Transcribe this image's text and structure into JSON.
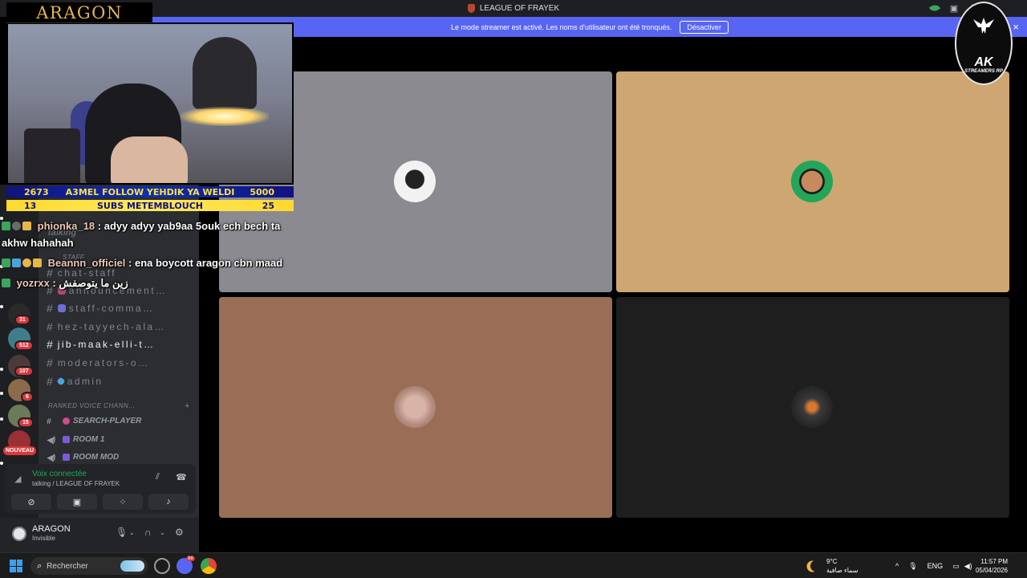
{
  "window": {
    "title": "LEAGUE OF FRAYEK"
  },
  "banner": {
    "text": "Le mode streamer est activé. Les noms d'utilisateur ont été tronqués.",
    "button": "Désactiver",
    "close": "×"
  },
  "overlay": {
    "logo": "ARAGON",
    "stats_row1": {
      "left": "2673",
      "middle": "A3MEL FOLLOW YEHDIK YA WELDI",
      "right": "5000"
    },
    "stats_row2": {
      "left": "13",
      "middle": "SUBS METEMBLOUCH",
      "right": "25"
    },
    "chat": [
      {
        "user": "phionka_18",
        "text": " : adyy adyy yab9aa 5ouk ech bech ta"
      },
      {
        "user": "",
        "text": "akhw hahahah"
      },
      {
        "user": "Beannn_officiel",
        "text": " : ena boycott aragon cbn maad"
      },
      {
        "user": "yozrxx",
        "text": " : زين ما يتوصفش"
      }
    ],
    "badge": {
      "title": "AK",
      "subtitle": "STREAMERS RP"
    }
  },
  "servers": {
    "badges": [
      "31",
      "512",
      "107",
      "6",
      "15"
    ],
    "new_label": "NOUVEAU"
  },
  "channels": {
    "partial_top": "talking",
    "category_staff": "STAFF",
    "items": [
      {
        "name": "chat-staff",
        "active": false
      },
      {
        "name": "announcement…",
        "active": false
      },
      {
        "name": "staff-comma…",
        "active": false
      },
      {
        "name": "hez-tayyech-ala…",
        "active": false
      },
      {
        "name": "jib-maak-elli-t…",
        "active": true
      },
      {
        "name": "moderators-o…",
        "active": false
      },
      {
        "name": "admin",
        "active": false
      }
    ],
    "category_ranked": "RANKED VOICE CHANN…",
    "voice": [
      {
        "name": "SEARCH-PLAYER"
      },
      {
        "name": "ROOM 1"
      },
      {
        "name": "ROOM MOD"
      }
    ]
  },
  "voice_panel": {
    "status": "Voix connectée",
    "channel": "talking / LEAGUE OF FRAYEK"
  },
  "user": {
    "name": "ARAGON",
    "status": "Invisible"
  },
  "taskbar": {
    "search_placeholder": "Rechercher",
    "weather_temp": "9°C",
    "weather_desc": "سماء صافية",
    "lang": "ENG",
    "time": "11:57 PM",
    "date": "05/04/2026",
    "discord_badge": "98"
  },
  "colors": {
    "accent": "#5865f2",
    "tile1": "#8b8a90",
    "tile2": "#cea672",
    "tile3": "#9a6d57",
    "tile4": "#1e1e1e",
    "connected": "#23a55a",
    "badge": "#da373c"
  }
}
